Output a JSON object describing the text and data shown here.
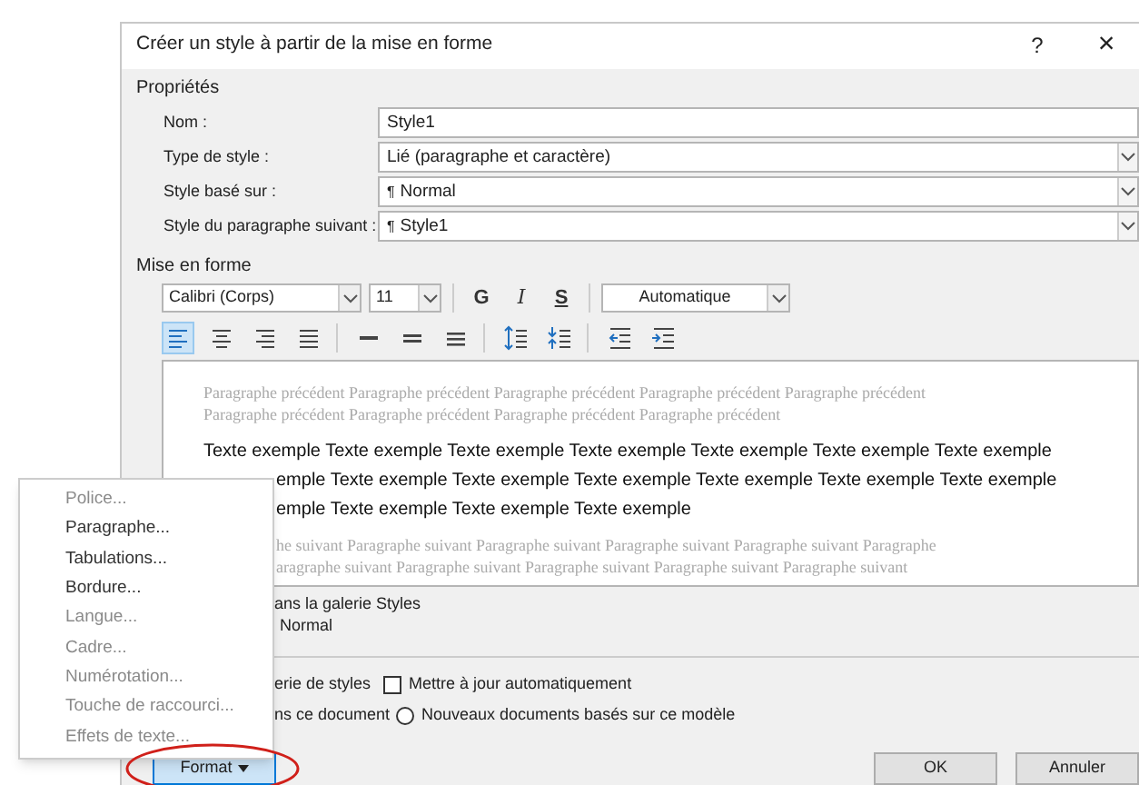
{
  "window": {
    "title": "Créer un style à partir de la mise en forme",
    "help": "?",
    "close": "×"
  },
  "properties": {
    "label": "Propriétés",
    "rows": [
      {
        "label": "Nom :",
        "value": "Style1",
        "kind": "text"
      },
      {
        "label": "Type de style :",
        "value": "Lié (paragraphe et caractère)",
        "kind": "dropdown"
      },
      {
        "label": "Style basé sur :",
        "value": "Normal",
        "mark": "¶",
        "kind": "dropdown"
      },
      {
        "label": "Style du paragraphe suivant :",
        "value": "Style1",
        "mark": "¶",
        "kind": "dropdown"
      }
    ]
  },
  "formatting": {
    "label": "Mise en forme",
    "font": "Calibri (Corps)",
    "size": "11",
    "styles": [
      {
        "label": "G",
        "kind": "bold"
      },
      {
        "label": "I",
        "kind": "italic"
      },
      {
        "label": "S",
        "kind": "underline"
      }
    ],
    "color_label": "Automatique",
    "tool_groups": [
      [
        {
          "kind": "align-left",
          "selected": true
        },
        {
          "kind": "align-center",
          "selected": false
        },
        {
          "kind": "align-right",
          "selected": false
        },
        {
          "kind": "justify",
          "selected": false
        }
      ],
      [
        {
          "kind": "spacing-single",
          "selected": false
        },
        {
          "kind": "spacing-onehalf",
          "selected": false
        },
        {
          "kind": "spacing-double",
          "selected": false
        }
      ],
      [
        {
          "kind": "line-spacing",
          "selected": false
        },
        {
          "kind": "paragraph-spacing",
          "selected": false
        }
      ],
      [
        {
          "kind": "indent-decrease",
          "selected": false
        },
        {
          "kind": "indent-increase",
          "selected": false
        }
      ]
    ]
  },
  "preview": {
    "lines": [
      {
        "kind": "previous",
        "clipped": false,
        "text": "Paragraphe précédent Paragraphe précédent Paragraphe précédent Paragraphe précédent Paragraphe précédent"
      },
      {
        "kind": "previous",
        "clipped": false,
        "text": "Paragraphe précédent Paragraphe précédent Paragraphe précédent Paragraphe précédent"
      },
      {
        "kind": "sample",
        "clipped": false,
        "text": "Texte exemple Texte exemple Texte exemple Texte exemple Texte exemple Texte exemple Texte exemple"
      },
      {
        "kind": "sample",
        "clipped": true,
        "text": "emple Texte exemple Texte exemple Texte exemple Texte exemple Texte exemple Texte exemple"
      },
      {
        "kind": "sample",
        "clipped": true,
        "text": "emple Texte exemple Texte exemple Texte exemple"
      },
      {
        "kind": "next",
        "clipped": true,
        "text": "he suivant Paragraphe suivant Paragraphe suivant Paragraphe suivant Paragraphe suivant Paragraphe"
      },
      {
        "kind": "next",
        "clipped": true,
        "text": "aragraphe suivant Paragraphe suivant Paragraphe suivant Paragraphe suivant Paragraphe suivant"
      }
    ]
  },
  "description": [
    "ans la galerie Styles",
    "Normal"
  ],
  "options": [
    {
      "clipped_label": "erie de styles",
      "kind": "checkbox",
      "label": "Mettre à jour automatiquement",
      "checked": false
    },
    {
      "clipped_label": "ns ce document",
      "kind": "radio",
      "label": "Nouveaux documents basés sur ce modèle",
      "selected": false
    }
  ],
  "buttons": {
    "format": "Format",
    "ok": "OK",
    "cancel": "Annuler"
  },
  "format_menu": [
    {
      "label": "Police...",
      "disabled": true
    },
    {
      "label": "Paragraphe...",
      "disabled": false
    },
    {
      "label": "Tabulations...",
      "disabled": false
    },
    {
      "label": "Bordure...",
      "disabled": false
    },
    {
      "label": "Langue...",
      "disabled": true
    },
    {
      "label": "Cadre...",
      "disabled": true
    },
    {
      "label": "Numérotation...",
      "disabled": true
    },
    {
      "label": "Touche de raccourci...",
      "disabled": true
    },
    {
      "label": "Effets de texte...",
      "disabled": true
    }
  ]
}
